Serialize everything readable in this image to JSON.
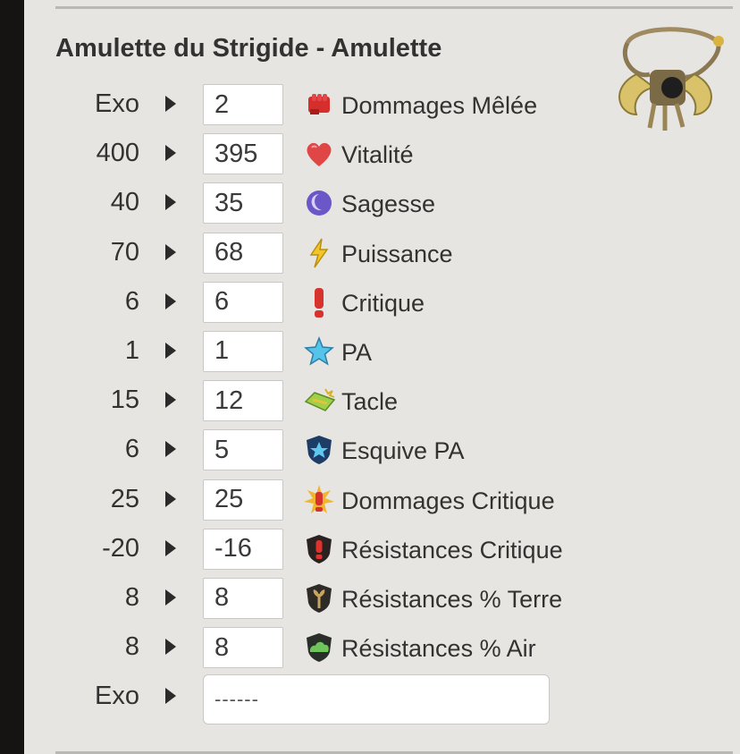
{
  "item": {
    "title": "Amulette du Strigide - Amulette",
    "image_icon": "amulet-icon"
  },
  "rows": [
    {
      "target": "Exo",
      "value": "2",
      "label": "Dommages Mêlée",
      "icon": "melee-damage-icon"
    },
    {
      "target": "400",
      "value": "395",
      "label": "Vitalité",
      "icon": "heart-icon"
    },
    {
      "target": "40",
      "value": "35",
      "label": "Sagesse",
      "icon": "wisdom-icon"
    },
    {
      "target": "70",
      "value": "68",
      "label": "Puissance",
      "icon": "lightning-icon"
    },
    {
      "target": "6",
      "value": "6",
      "label": "Critique",
      "icon": "exclamation-icon"
    },
    {
      "target": "1",
      "value": "1",
      "label": "PA",
      "icon": "star-icon"
    },
    {
      "target": "15",
      "value": "12",
      "label": "Tacle",
      "icon": "tackle-icon"
    },
    {
      "target": "6",
      "value": "5",
      "label": "Esquive PA",
      "icon": "dodge-ap-icon"
    },
    {
      "target": "25",
      "value": "25",
      "label": "Dommages Critique",
      "icon": "critical-damage-icon"
    },
    {
      "target": "-20",
      "value": "-16",
      "label": "Résistances Critique",
      "icon": "critical-resistance-icon"
    },
    {
      "target": "8",
      "value": "8",
      "label": "Résistances % Terre",
      "icon": "earth-resistance-icon"
    },
    {
      "target": "8",
      "value": "8",
      "label": "Résistances % Air",
      "icon": "air-resistance-icon"
    }
  ],
  "exo_row": {
    "target": "Exo",
    "value": "------"
  },
  "colors": {
    "background": "#e6e5e2",
    "text": "#333231",
    "left_bar": "#151412"
  }
}
